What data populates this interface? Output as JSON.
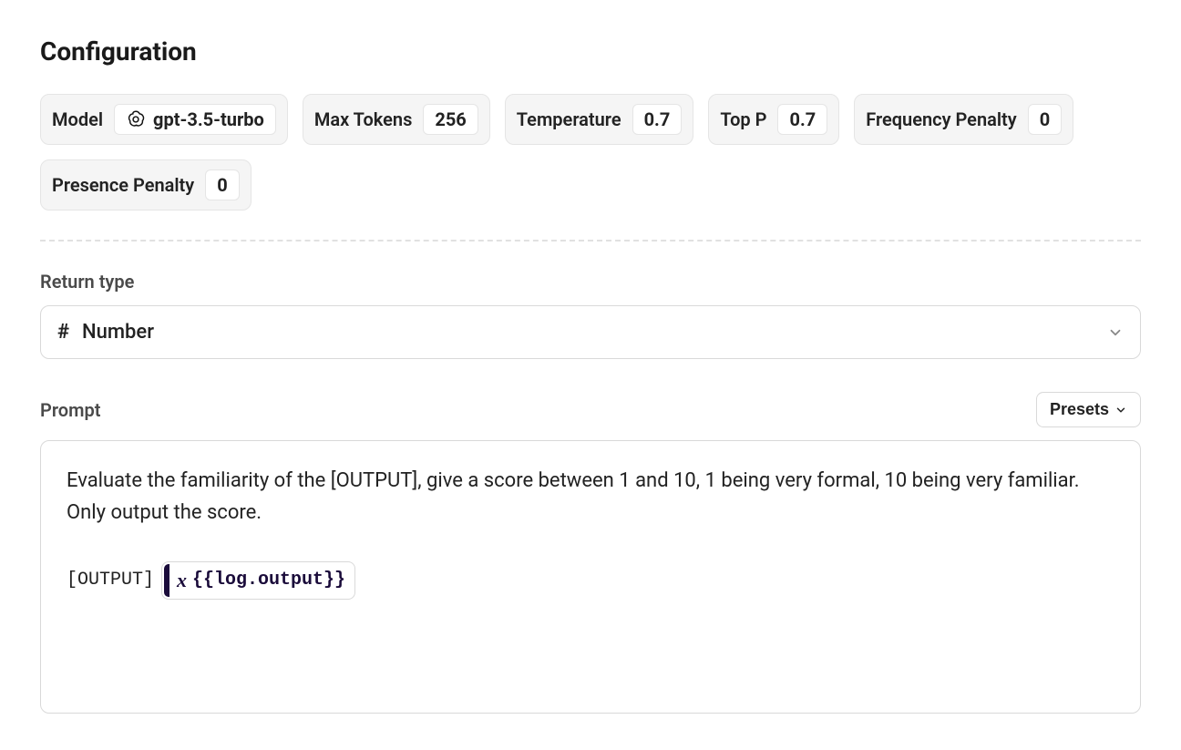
{
  "heading": "Configuration",
  "config": {
    "model": {
      "label": "Model",
      "value": "gpt-3.5-turbo",
      "icon": "openai"
    },
    "max_tokens": {
      "label": "Max Tokens",
      "value": "256"
    },
    "temperature": {
      "label": "Temperature",
      "value": "0.7"
    },
    "top_p": {
      "label": "Top P",
      "value": "0.7"
    },
    "frequency_penalty": {
      "label": "Frequency Penalty",
      "value": "0"
    },
    "presence_penalty": {
      "label": "Presence Penalty",
      "value": "0"
    }
  },
  "return_type": {
    "label": "Return type",
    "selected": "Number"
  },
  "prompt_section": {
    "label": "Prompt",
    "presets_label": "Presets",
    "text": "Evaluate the familiarity of the [OUTPUT], give a score between 1 and 10, 1 being very formal, 10 being very familiar. Only output the score.",
    "output_label": "[OUTPUT]",
    "variable_token": "{{log.output}}"
  }
}
